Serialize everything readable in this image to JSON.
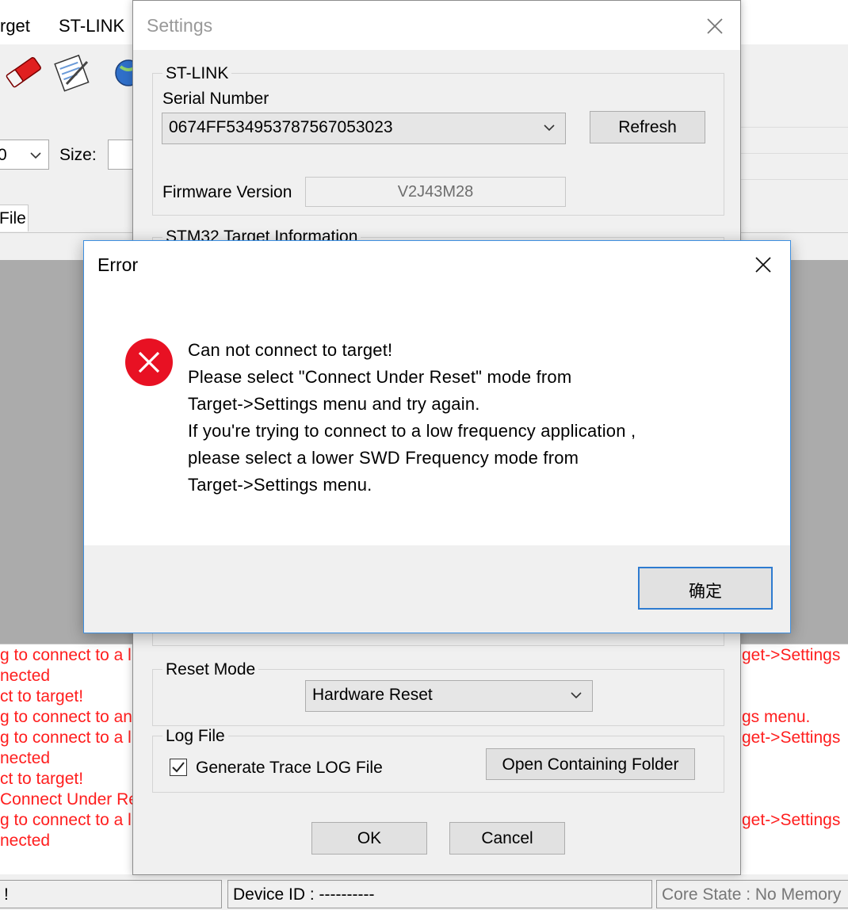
{
  "app": {
    "menu": [
      "rget",
      "ST-LINK"
    ],
    "address_combo_value": "0",
    "size_label": "Size:",
    "file_tab": "File",
    "log_lines": [
      "g to connect to a l",
      "nected",
      "ct to target!",
      "g to connect to an",
      "g to connect to a l",
      "nected",
      "ct to target!",
      "Connect Under Re",
      "g to connect to a l",
      "nected"
    ],
    "log_lines_right": [
      "get->Settings",
      "gs menu.",
      "get->Settings",
      "get->Settings"
    ],
    "status": {
      "left": "!",
      "device_id": "Device ID : ----------",
      "core_state": "Core State : No Memory"
    }
  },
  "settings": {
    "title": "Settings",
    "stlink_group": "ST-LINK",
    "serial_label": "Serial Number",
    "serial_value": "0674FF534953787567053023",
    "refresh_button": "Refresh",
    "firmware_label": "Firmware Version",
    "firmware_value": "V2J43M28",
    "target_group": "STM32 Target Information",
    "reset_group": "Reset Mode",
    "reset_value": "Hardware Reset",
    "log_group": "Log File",
    "log_checkbox_label": "Generate Trace LOG File",
    "log_checked": true,
    "open_folder_button": "Open Containing Folder",
    "ok_button": "OK",
    "cancel_button": "Cancel"
  },
  "error": {
    "title": "Error",
    "lines": [
      "Can not connect to target!",
      "Please select \"Connect Under Reset\" mode from",
      "Target->Settings menu and try again.",
      "If you're trying to connect to a low frequency application ,",
      "please select a lower SWD Frequency mode from",
      "Target->Settings menu."
    ],
    "confirm_button": "确定"
  },
  "colors": {
    "log_text": "#ff1e1e",
    "error_icon": "#e81123",
    "focus_border": "#2e7bd0"
  }
}
